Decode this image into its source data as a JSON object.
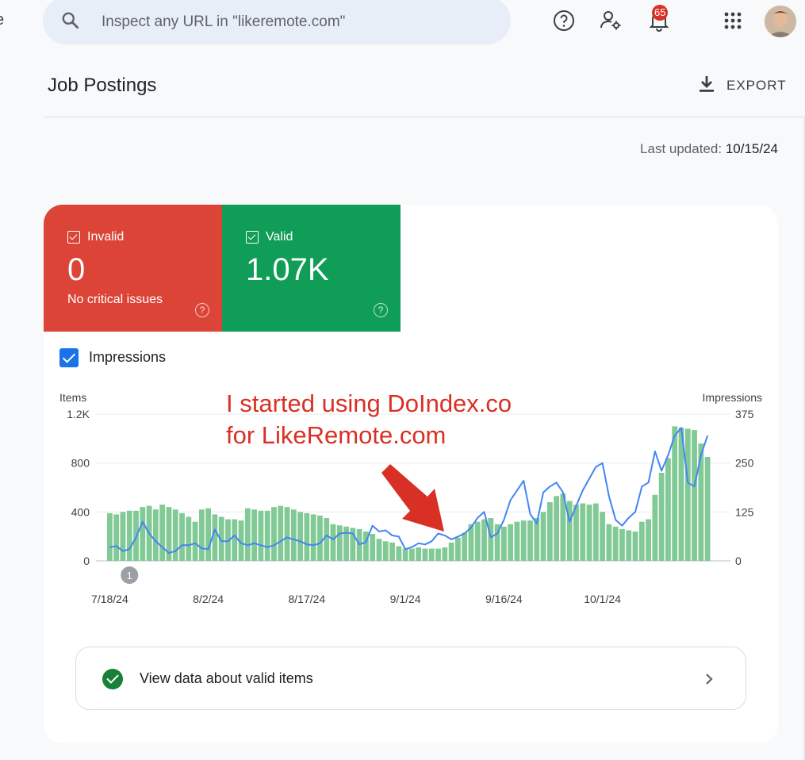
{
  "search": {
    "placeholder": "Inspect any URL in \"likeremote.com\""
  },
  "header": {
    "notifications_count": "65",
    "edge_letter": "e"
  },
  "page": {
    "title": "Job Postings",
    "export_label": "EXPORT",
    "last_updated_label": "Last updated:",
    "last_updated_value": "10/15/24"
  },
  "tiles": {
    "invalid": {
      "label": "Invalid",
      "value": "0",
      "sub": "No critical issues",
      "color": "#dc4437"
    },
    "valid": {
      "label": "Valid",
      "value": "1.07K",
      "color": "#0f9d58"
    }
  },
  "impressions_toggle": {
    "label": "Impressions",
    "checked": true
  },
  "annotation": {
    "line1": "I started using DoIndex.co",
    "line2": "for LikeRemote.com",
    "color": "#d93025"
  },
  "valid_row": {
    "label": "View data about valid items"
  },
  "chart_data": {
    "type": "bar",
    "left_axis_title": "Items",
    "right_axis_title": "Impressions",
    "left_ticks": [
      "0",
      "400",
      "800",
      "1.2K"
    ],
    "right_ticks": [
      "0",
      "125",
      "250",
      "375"
    ],
    "ylim_left": [
      0,
      1200
    ],
    "ylim_right": [
      0,
      375
    ],
    "x_tick_labels": [
      {
        "index": 0,
        "label": "7/18/24"
      },
      {
        "index": 15,
        "label": "8/2/24"
      },
      {
        "index": 30,
        "label": "8/17/24"
      },
      {
        "index": 45,
        "label": "9/1/24"
      },
      {
        "index": 60,
        "label": "9/16/24"
      },
      {
        "index": 75,
        "label": "10/1/24"
      }
    ],
    "marker": {
      "index": 3,
      "label": "1"
    },
    "bar_color": "#81c995",
    "line_color": "#4285f4",
    "series": [
      {
        "kind": "bars",
        "values": [
          390,
          380,
          400,
          410,
          410,
          440,
          450,
          420,
          460,
          440,
          420,
          390,
          360,
          320,
          420,
          430,
          380,
          360,
          340,
          340,
          330,
          430,
          420,
          410,
          410,
          440,
          450,
          440,
          420,
          400,
          390,
          380,
          370,
          350,
          300,
          290,
          280,
          270,
          260,
          240,
          220,
          180,
          160,
          150,
          120,
          100,
          100,
          110,
          100,
          100,
          100,
          110,
          150,
          190,
          230,
          300,
          320,
          340,
          350,
          300,
          280,
          300,
          320,
          330,
          330,
          350,
          400,
          480,
          530,
          550,
          490,
          460,
          470,
          460,
          470,
          400,
          300,
          280,
          260,
          250,
          240,
          320,
          340,
          540,
          720,
          840,
          1100,
          1090,
          1080,
          1070,
          960,
          850
        ]
      },
      {
        "kind": "line",
        "values": [
          35,
          38,
          25,
          30,
          60,
          100,
          70,
          50,
          35,
          20,
          25,
          40,
          40,
          45,
          32,
          30,
          80,
          50,
          50,
          65,
          45,
          40,
          45,
          40,
          35,
          40,
          50,
          60,
          55,
          50,
          42,
          40,
          45,
          65,
          55,
          70,
          72,
          70,
          42,
          48,
          90,
          75,
          78,
          65,
          62,
          30,
          35,
          45,
          42,
          50,
          70,
          65,
          55,
          62,
          70,
          85,
          110,
          125,
          60,
          70,
          105,
          155,
          180,
          205,
          120,
          95,
          175,
          190,
          200,
          175,
          100,
          140,
          180,
          210,
          240,
          250,
          165,
          105,
          90,
          110,
          125,
          190,
          200,
          280,
          230,
          270,
          320,
          340,
          200,
          190,
          270,
          320
        ]
      }
    ]
  }
}
